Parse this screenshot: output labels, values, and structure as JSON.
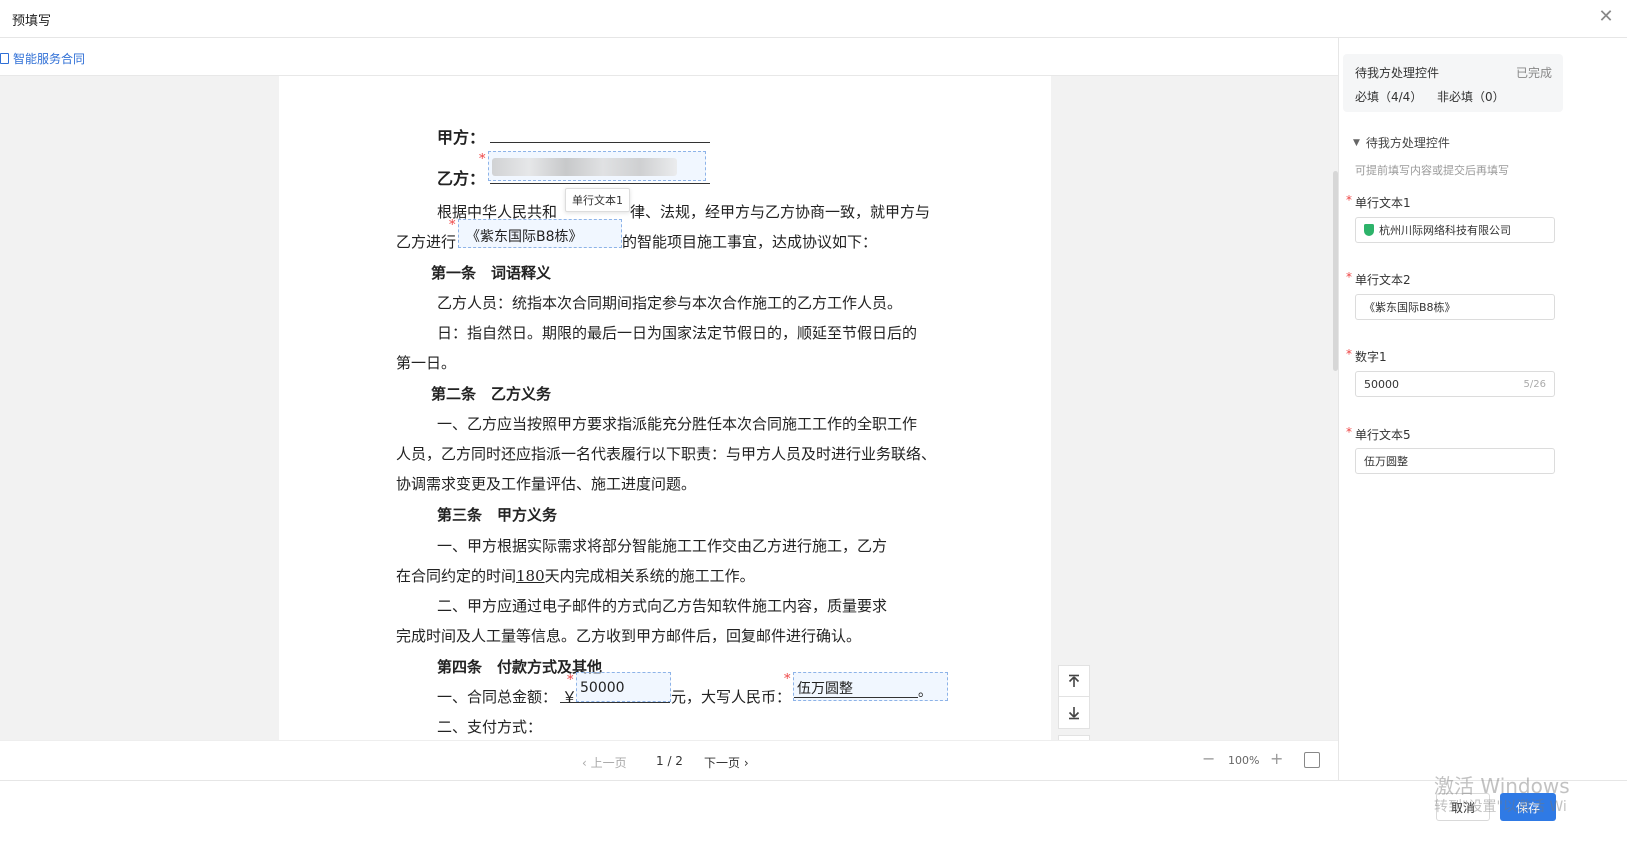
{
  "window": {
    "title": "预填写",
    "close": "✕"
  },
  "breadcrumb": {
    "label": "智能服务合同"
  },
  "document": {
    "party_a": "甲方：",
    "party_b": "乙方：",
    "tooltip": "单行文本1",
    "p1_a": "根据中华人民共和",
    "p1_b": "律、法规，经甲方与乙方协商一致，就甲方与",
    "p2_a": "乙方进行",
    "p2_field": "《紫东国际B8栋》",
    "p2_b": "的智能项目施工事宜，达成协议如下：",
    "art1": "第一条　词语释义",
    "art1_l1": "乙方人员：统指本次合同期间指定参与本次合作施工的乙方工作人员。",
    "art1_l2": "日：指自然日。期限的最后一日为国家法定节假日的，顺延至节假日后的",
    "art1_l3": "第一日。",
    "art2": "第二条　乙方义务",
    "art2_l1": "一、乙方应当按照甲方要求指派能充分胜任本次合同施工工作的全职工作",
    "art2_l2": "人员，乙方同时还应指派一名代表履行以下职责：与甲方人员及时进行业务联络、",
    "art2_l3": "协调需求变更及工作量评估、施工进度问题。",
    "art3": "第三条　甲方义务",
    "art3_l1": "一、甲方根据实际需求将部分智能施工工作交由乙方进行施工，乙方",
    "art3_l2a": "在合同约定的时间",
    "art3_days": "180",
    "art3_l2b": "天内完成相关系统的施工工作。",
    "art3_l3": "二、甲方应通过电子邮件的方式向乙方告知软件施工内容，质量要求",
    "art3_l4": "完成时间及人工量等信息。乙方收到甲方邮件后，回复邮件进行确认。",
    "art4": "第四条　付款方式及其他",
    "art4_l1a": "一、合同总金额：",
    "currency": "￥",
    "amount": "50000",
    "art4_l1b": "元，大写人民币：",
    "amount_words": "伍万圆整",
    "period": "。",
    "art4_l2": "二、支付方式：",
    "required_mark": "*"
  },
  "pager": {
    "prev": "‹ 上一页",
    "count": "1 / 2",
    "next": "下一页 ›",
    "zoom_out": "−",
    "zoom": "100%",
    "zoom_in": "+"
  },
  "panel": {
    "summary_title": "待我方处理控件",
    "status": "已完成",
    "required_count": "必填（4/4）",
    "optional_count": "非必填（0）",
    "section_title": "待我方处理控件",
    "hint": "可提前填写内容或提交后再填写",
    "fields": [
      {
        "label": "单行文本1",
        "value": "杭州川际网络科技有限公司"
      },
      {
        "label": "单行文本2",
        "value": "《紫东国际B8栋》"
      },
      {
        "label": "数字1",
        "value": "50000",
        "counter": "5/26"
      },
      {
        "label": "单行文本5",
        "value": "伍万圆整"
      }
    ]
  },
  "footer": {
    "cancel": "取消",
    "save": "保存"
  },
  "watermark": {
    "line1": "激活 Windows",
    "line2": "转到\"设置\"以激活 Wi"
  },
  "colors": {
    "accent": "#2f7ae5",
    "link": "#2f6fd6",
    "required": "#e44444"
  }
}
